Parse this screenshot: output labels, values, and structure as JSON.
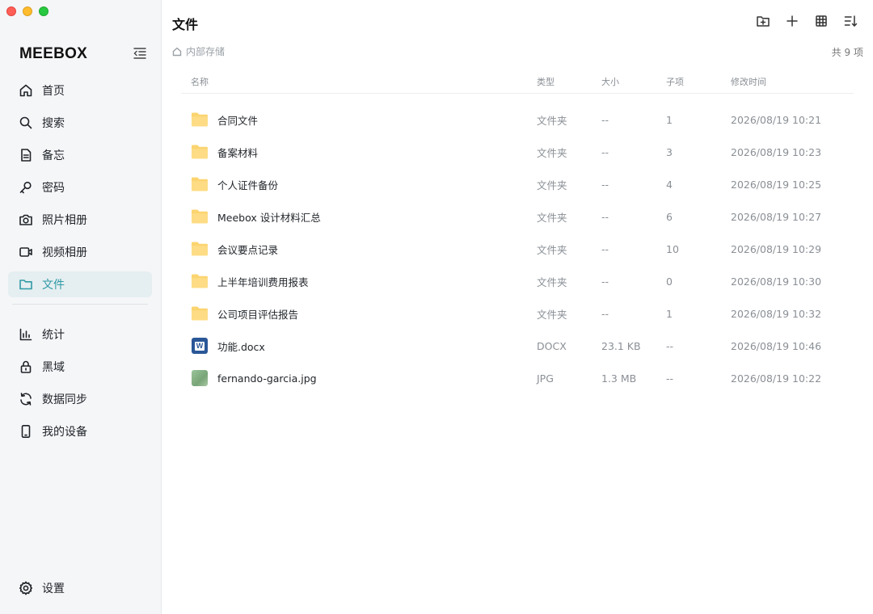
{
  "app": {
    "brand": "MEEBOX"
  },
  "sidebar": {
    "items": [
      {
        "label": "首页",
        "icon": "home-icon"
      },
      {
        "label": "搜索",
        "icon": "search-icon"
      },
      {
        "label": "备忘",
        "icon": "note-icon"
      },
      {
        "label": "密码",
        "icon": "key-icon"
      },
      {
        "label": "照片相册",
        "icon": "camera-icon"
      },
      {
        "label": "视频相册",
        "icon": "video-icon"
      },
      {
        "label": "文件",
        "icon": "folder-icon",
        "active": true
      }
    ],
    "items2": [
      {
        "label": "统计",
        "icon": "chart-icon"
      },
      {
        "label": "黑域",
        "icon": "lock-icon"
      },
      {
        "label": "数据同步",
        "icon": "sync-icon"
      },
      {
        "label": "我的设备",
        "icon": "phone-icon"
      }
    ],
    "settings": {
      "label": "设置",
      "icon": "gear-icon"
    }
  },
  "header": {
    "title": "文件",
    "breadcrumb": "内部存储",
    "count": "共 9 项"
  },
  "table": {
    "columns": {
      "name": "名称",
      "type": "类型",
      "size": "大小",
      "children": "子项",
      "modified": "修改时间"
    },
    "rows": [
      {
        "name": "合同文件",
        "type": "文件夹",
        "size": "--",
        "children": "1",
        "modified": "2026/08/19 10:21",
        "kind": "folder"
      },
      {
        "name": "备案材料",
        "type": "文件夹",
        "size": "--",
        "children": "3",
        "modified": "2026/08/19 10:23",
        "kind": "folder"
      },
      {
        "name": "个人证件备份",
        "type": "文件夹",
        "size": "--",
        "children": "4",
        "modified": "2026/08/19 10:25",
        "kind": "folder"
      },
      {
        "name": "Meebox 设计材料汇总",
        "type": "文件夹",
        "size": "--",
        "children": "6",
        "modified": "2026/08/19 10:27",
        "kind": "folder"
      },
      {
        "name": "会议要点记录",
        "type": "文件夹",
        "size": "--",
        "children": "10",
        "modified": "2026/08/19 10:29",
        "kind": "folder"
      },
      {
        "name": "上半年培训费用报表",
        "type": "文件夹",
        "size": "--",
        "children": "0",
        "modified": "2026/08/19 10:30",
        "kind": "folder"
      },
      {
        "name": "公司项目评估报告",
        "type": "文件夹",
        "size": "--",
        "children": "1",
        "modified": "2026/08/19 10:32",
        "kind": "folder"
      },
      {
        "name": "功能.docx",
        "type": "DOCX",
        "size": "23.1 KB",
        "children": "--",
        "modified": "2026/08/19 10:46",
        "kind": "word"
      },
      {
        "name": "fernando-garcia.jpg",
        "type": "JPG",
        "size": "1.3 MB",
        "children": "--",
        "modified": "2026/08/19 10:22",
        "kind": "image"
      }
    ]
  },
  "colors": {
    "accent": "#2f9aa6",
    "folder": "#fcd470",
    "sidebar_bg": "#f5f6f8",
    "active_bg": "#e5eef0"
  }
}
